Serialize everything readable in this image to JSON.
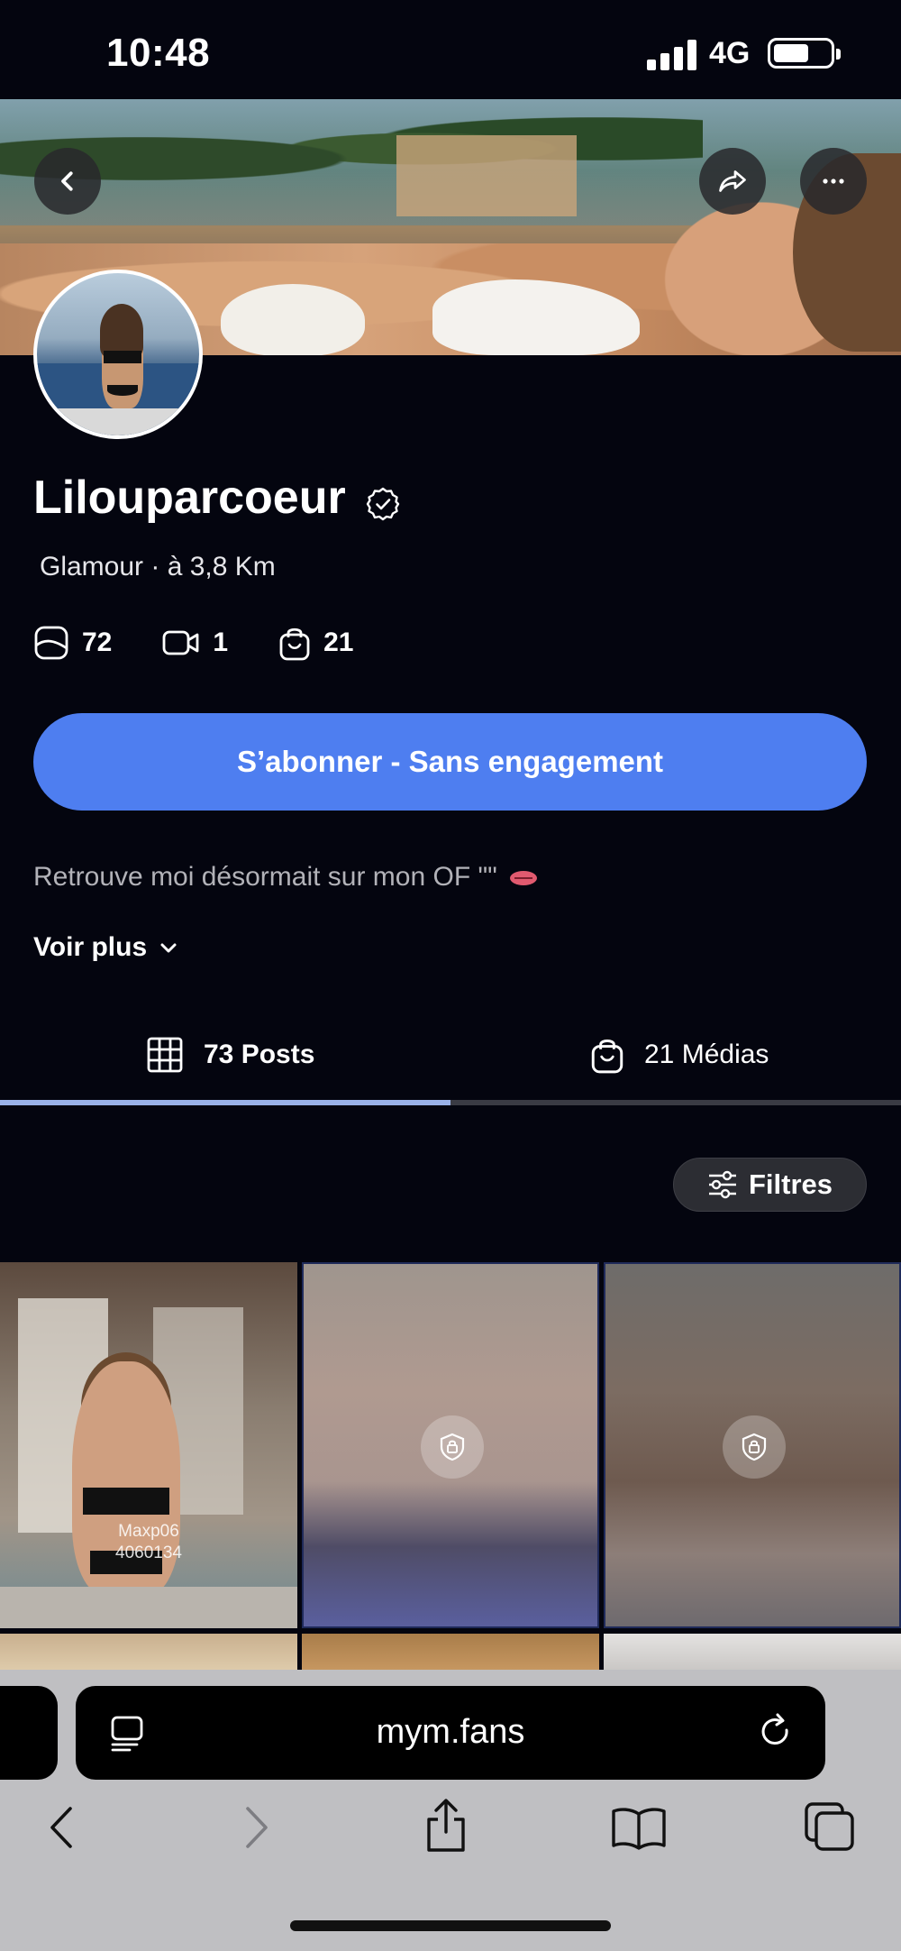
{
  "status": {
    "time": "10:48",
    "network": "4G"
  },
  "profile": {
    "name": "Lilouparcoeur",
    "category": "Glamour",
    "distance": "à 3,8 Km",
    "stats": {
      "posts": "72",
      "videos": "1",
      "media": "21"
    },
    "subscribe_label": "S’abonner - Sans engagement",
    "bio": "Retrouve moi désormait sur mon OF \"\"",
    "see_more": "Voir plus"
  },
  "tabs": {
    "posts": "73 Posts",
    "media": "21 Médias"
  },
  "filters_label": "Filtres",
  "grid": {
    "watermark_line1": "Maxp06",
    "watermark_line2": "4060134"
  },
  "browser": {
    "url": "mym.fans"
  },
  "colors": {
    "accent": "#4e7ef0",
    "background": "#04050f",
    "active_tab_line": "#9ab2e8"
  },
  "icons": [
    "back-icon",
    "share-icon",
    "more-icon",
    "verified-icon",
    "photo-icon",
    "video-icon",
    "bag-icon",
    "chevron-down-icon",
    "grid-icon",
    "filters-icon",
    "lock-icon",
    "reader-icon",
    "reload-icon",
    "browser-back-icon",
    "browser-forward-icon",
    "browser-share-icon",
    "bookmarks-icon",
    "tabs-icon"
  ]
}
